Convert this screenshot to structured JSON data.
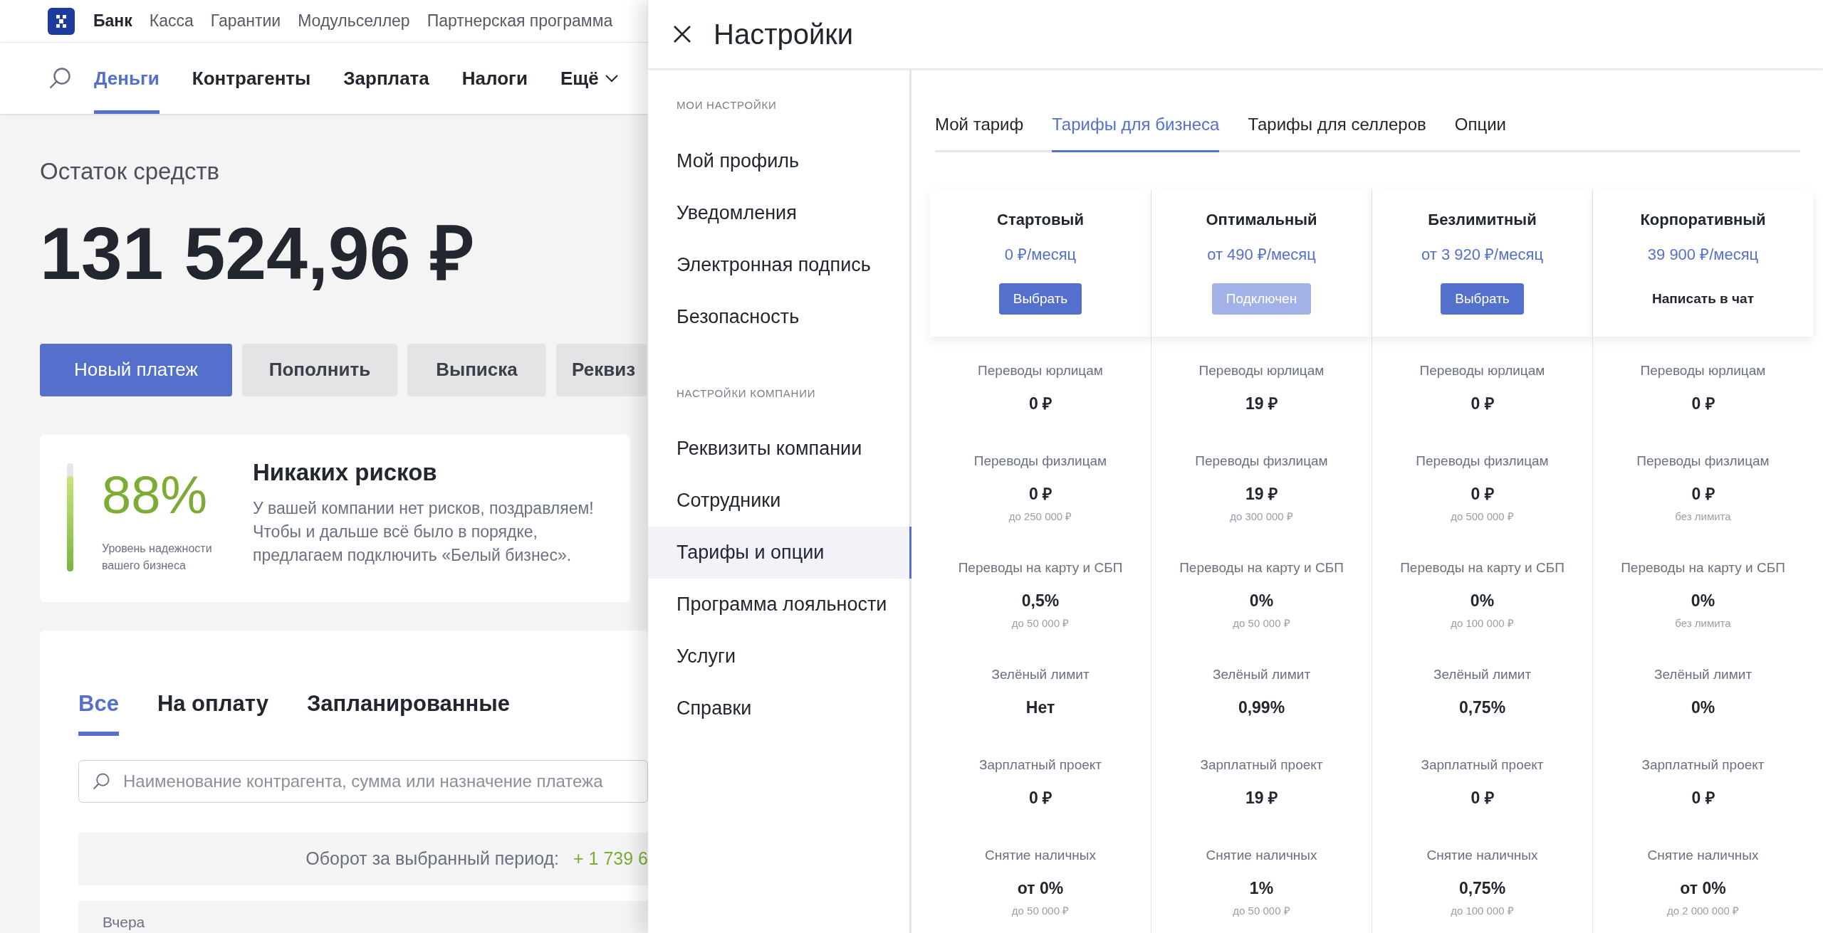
{
  "top_links": [
    {
      "label": "Банк",
      "selected": true
    },
    {
      "label": "Касса",
      "selected": false
    },
    {
      "label": "Гарантии",
      "selected": false
    },
    {
      "label": "Модульселлер",
      "selected": false
    },
    {
      "label": "Партнерская программа",
      "selected": false
    }
  ],
  "nav": [
    {
      "label": "Деньги",
      "selected": true
    },
    {
      "label": "Контрагенты",
      "selected": false
    },
    {
      "label": "Зарплата",
      "selected": false
    },
    {
      "label": "Налоги",
      "selected": false
    },
    {
      "label": "Ещё",
      "selected": false
    }
  ],
  "balance": {
    "label": "Остаток средств",
    "amount": "131 524,96 ₽"
  },
  "actions": [
    {
      "label": "Новый платеж",
      "kind": "primary"
    },
    {
      "label": "Пополнить",
      "kind": "secondary"
    },
    {
      "label": "Выписка",
      "kind": "secondary"
    },
    {
      "label": "Реквиз",
      "kind": "secondary"
    }
  ],
  "risk_card": {
    "percent": "88%",
    "level": 0.88,
    "caption": "Уровень надежности вашего бизнеса",
    "title": "Никаких рисков",
    "text": "У вашей компании нет рисков, поздравляем! Чтобы и дальше всё было в порядке, предлагаем подключить «Белый бизнес»."
  },
  "payments": {
    "tabs": [
      {
        "label": "Все",
        "selected": true
      },
      {
        "label": "На оплату",
        "selected": false
      },
      {
        "label": "Запланированные",
        "selected": false
      }
    ],
    "search": {
      "placeholder": "Наименование контрагента, сумма или назначение платежа"
    },
    "turnover": {
      "label": "Оборот за выбранный период:",
      "value": "+ 1 739 6"
    },
    "group": "Вчера"
  },
  "settings": {
    "title": "Настройки",
    "sidebar": [
      {
        "heading": "МОИ НАСТРОЙКИ",
        "items": [
          {
            "label": "Мой профиль",
            "selected": false
          },
          {
            "label": "Уведомления",
            "selected": false
          },
          {
            "label": "Электронная подпись",
            "selected": false
          },
          {
            "label": "Безопасность",
            "selected": false
          }
        ]
      },
      {
        "heading": "НАСТРОЙКИ КОМПАНИИ",
        "items": [
          {
            "label": "Реквизиты компании",
            "selected": false
          },
          {
            "label": "Сотрудники",
            "selected": false
          },
          {
            "label": "Тарифы и опции",
            "selected": true
          },
          {
            "label": "Программа лояльности",
            "selected": false
          },
          {
            "label": "Услуги",
            "selected": false
          },
          {
            "label": "Справки",
            "selected": false
          }
        ]
      }
    ],
    "tabs": [
      {
        "label": "Мой тариф",
        "selected": false
      },
      {
        "label": "Тарифы для бизнеса",
        "selected": true
      },
      {
        "label": "Тарифы для селлеров",
        "selected": false
      },
      {
        "label": "Опции",
        "selected": false
      }
    ],
    "plans": [
      {
        "name": "Стартовый",
        "price": "0 ₽/месяц",
        "action": {
          "kind": "button",
          "label": "Выбрать"
        },
        "features": [
          {
            "label": "Переводы юрлицам",
            "value": "0 ₽"
          },
          {
            "label": "Переводы физлицам",
            "value": "0 ₽",
            "note": "до 250 000 ₽"
          },
          {
            "label": "Переводы на карту и СБП",
            "value": "0,5%",
            "note": "до 50 000 ₽"
          },
          {
            "label": "Зелёный лимит",
            "value": "Нет"
          },
          {
            "label": "Зарплатный проект",
            "value": "0 ₽"
          },
          {
            "label": "Снятие наличных",
            "value": "от 0%",
            "note": "до 50 000 ₽"
          }
        ]
      },
      {
        "name": "Оптимальный",
        "price": "от 490 ₽/месяц",
        "action": {
          "kind": "disabled",
          "label": "Подключен"
        },
        "features": [
          {
            "label": "Переводы юрлицам",
            "value": "19 ₽"
          },
          {
            "label": "Переводы физлицам",
            "value": "19 ₽",
            "note": "до 300 000 ₽"
          },
          {
            "label": "Переводы на карту и СБП",
            "value": "0%",
            "note": "до 50 000 ₽"
          },
          {
            "label": "Зелёный лимит",
            "value": "0,99%"
          },
          {
            "label": "Зарплатный проект",
            "value": "19 ₽"
          },
          {
            "label": "Снятие наличных",
            "value": "1%",
            "note": "до 50 000 ₽"
          }
        ]
      },
      {
        "name": "Безлимитный",
        "price": "от 3 920 ₽/месяц",
        "action": {
          "kind": "button",
          "label": "Выбрать"
        },
        "features": [
          {
            "label": "Переводы юрлицам",
            "value": "0 ₽"
          },
          {
            "label": "Переводы физлицам",
            "value": "0 ₽",
            "note": "до 500 000 ₽"
          },
          {
            "label": "Переводы на карту и СБП",
            "value": "0%",
            "note": "до 100 000 ₽"
          },
          {
            "label": "Зелёный лимит",
            "value": "0,75%"
          },
          {
            "label": "Зарплатный проект",
            "value": "0 ₽"
          },
          {
            "label": "Снятие наличных",
            "value": "0,75%",
            "note": "до 100 000 ₽"
          }
        ]
      },
      {
        "name": "Корпоративный",
        "price": "39 900 ₽/месяц",
        "action": {
          "kind": "link",
          "label": "Написать в чат"
        },
        "features": [
          {
            "label": "Переводы юрлицам",
            "value": "0 ₽"
          },
          {
            "label": "Переводы физлицам",
            "value": "0 ₽",
            "note": "без лимита"
          },
          {
            "label": "Переводы на карту и СБП",
            "value": "0%",
            "note": "без лимита"
          },
          {
            "label": "Зелёный лимит",
            "value": "0%"
          },
          {
            "label": "Зарплатный проект",
            "value": "0 ₽"
          },
          {
            "label": "Снятие наличных",
            "value": "от 0%",
            "note": "до 2 000 000 ₽"
          }
        ]
      }
    ]
  }
}
